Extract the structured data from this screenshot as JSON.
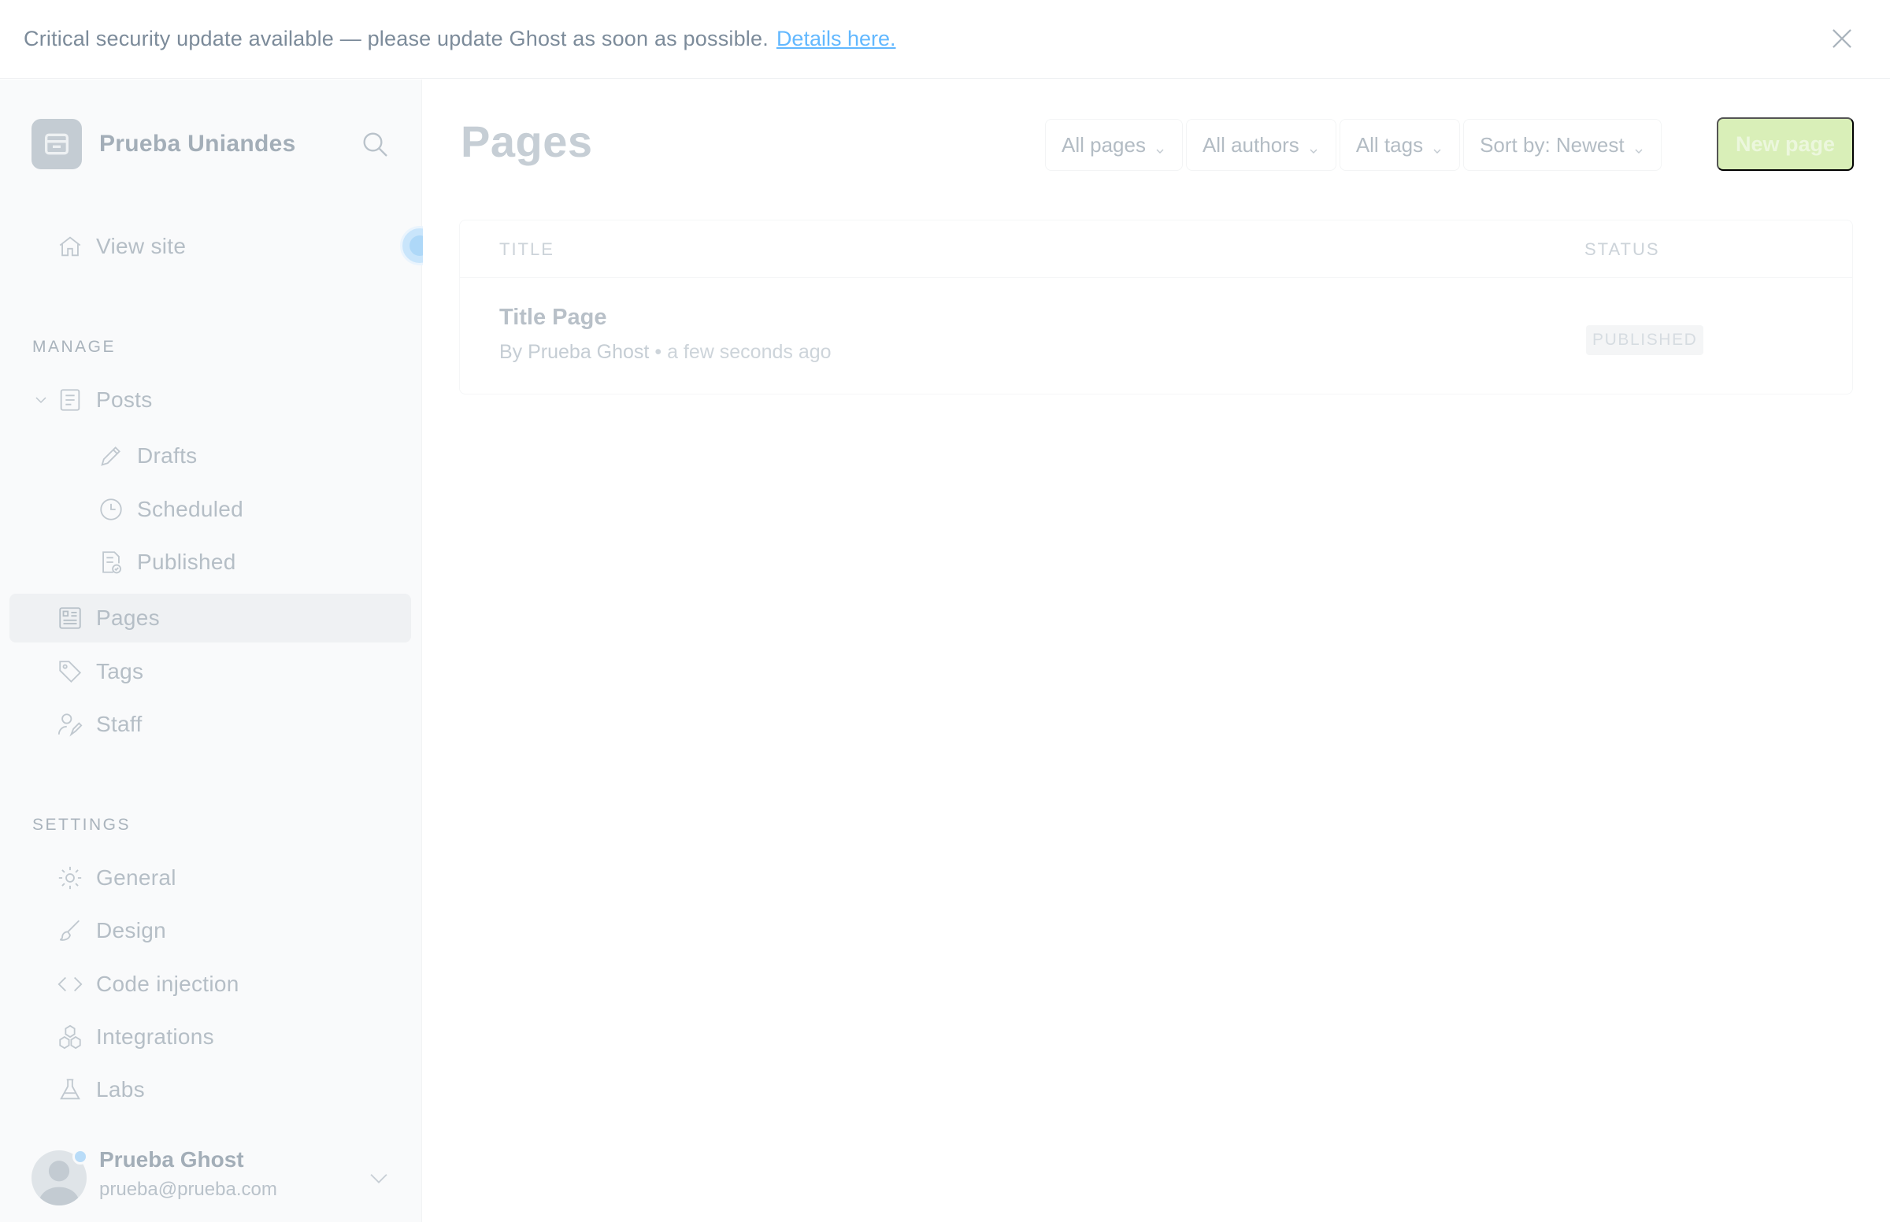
{
  "banner": {
    "message": "Critical security update available — please update Ghost as soon as possible.",
    "link_text": "Details here."
  },
  "sidebar": {
    "brand_name": "Prueba Uniandes",
    "view_site": "View site",
    "manage_label": "MANAGE",
    "manage_items": {
      "posts": "Posts",
      "drafts": "Drafts",
      "scheduled": "Scheduled",
      "published": "Published",
      "pages": "Pages",
      "tags": "Tags",
      "staff": "Staff"
    },
    "settings_label": "SETTINGS",
    "settings_items": {
      "general": "General",
      "design": "Design",
      "code_injection": "Code injection",
      "integrations": "Integrations",
      "labs": "Labs"
    },
    "user": {
      "name": "Prueba Ghost",
      "email": "prueba@prueba.com"
    }
  },
  "main": {
    "title": "Pages",
    "filters": {
      "type": "All pages",
      "authors": "All authors",
      "tags": "All tags",
      "sort": "Sort by: Newest"
    },
    "new_button": "New page",
    "table": {
      "col_title": "TITLE",
      "col_status": "STATUS",
      "rows": [
        {
          "title": "Title Page",
          "author": "By Prueba Ghost",
          "separator": "•",
          "time": "a few seconds ago",
          "status": "PUBLISHED"
        }
      ]
    }
  },
  "colors": {
    "accent_green": "#d9efb8",
    "link_blue": "#62b8ff",
    "sidebar_bg": "#f9fafb"
  }
}
